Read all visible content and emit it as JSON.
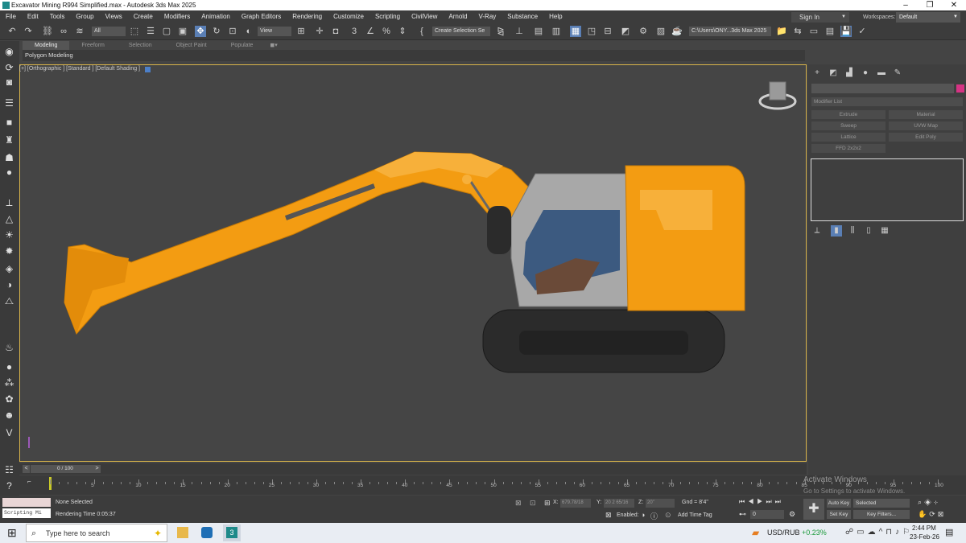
{
  "window": {
    "title": "Excavator Mining R994 Simplified.max - Autodesk 3ds Max 2025"
  },
  "menubar": {
    "items": [
      "File",
      "Edit",
      "Tools",
      "Group",
      "Views",
      "Create",
      "Modifiers",
      "Animation",
      "Graph Editors",
      "Rendering",
      "Customize",
      "Scripting",
      "CivilView",
      "Arnold",
      "V-Ray",
      "Substance",
      "Help"
    ],
    "sign_in": "Sign In",
    "workspaces_label": "Workspaces:",
    "workspaces_value": "Default"
  },
  "toolbar": {
    "selection_filter": "All",
    "ref_coord": "View",
    "selection_set": "Create Selection Se",
    "project_path": "C:\\Users\\ONY...3ds Max 2025"
  },
  "ribbon": {
    "tabs": [
      "Modeling",
      "Freeform",
      "Selection",
      "Object Paint",
      "Populate"
    ],
    "active_tab": "Modeling",
    "sub_label": "Polygon Modeling"
  },
  "viewport": {
    "label": "[+] [Orthographic ] [Standard ] [Default Shading ]",
    "colors": {
      "border": "#d8b44a",
      "excavator": "#f39c12",
      "cab": "#a8a8a8",
      "track": "#2b2b2b",
      "glass": "#3c5a80"
    }
  },
  "command_panel": {
    "modifier_list": "Modifier List",
    "buttons": [
      "Extrude",
      "Material",
      "Sweep",
      "UVW Map",
      "Lattice",
      "Edit Poly",
      "FFD 2x2x2"
    ]
  },
  "timeslider": {
    "frame": "0 / 100",
    "prev": "<",
    "next": ">"
  },
  "trackbar": {
    "ticks": [
      "5",
      "10",
      "15",
      "20",
      "25",
      "30",
      "35",
      "40",
      "45",
      "50",
      "55",
      "60",
      "65",
      "70",
      "75",
      "80",
      "85",
      "90",
      "95",
      "100"
    ]
  },
  "status": {
    "selection": "None Selected",
    "render_time": "Rendering Time  0:05:37",
    "script_label": "Scripting Mi",
    "x_label": "X:",
    "x_value": "679.78/18",
    "y_label": "Y:",
    "y_value": "20 2 65/16",
    "z_label": "Z:",
    "z_value": "20\"",
    "grid": "Gnd = 8'4\"",
    "enabled_label": "Enabled:",
    "add_time_tag": "Add Time Tag",
    "auto_key": "Auto Key",
    "set_key": "Set Key",
    "selected": "Selected",
    "key_filters": "Key Filters...",
    "frame_field": "0"
  },
  "watermark": {
    "line1": "Activate Windows",
    "line2": "Go to Settings to activate Windows."
  },
  "taskbar": {
    "search_placeholder": "Type here to search",
    "ticker_name": "USD/RUB",
    "ticker_change": "+0.23%",
    "time": "2:44 PM",
    "date": "23-Feb-26"
  }
}
